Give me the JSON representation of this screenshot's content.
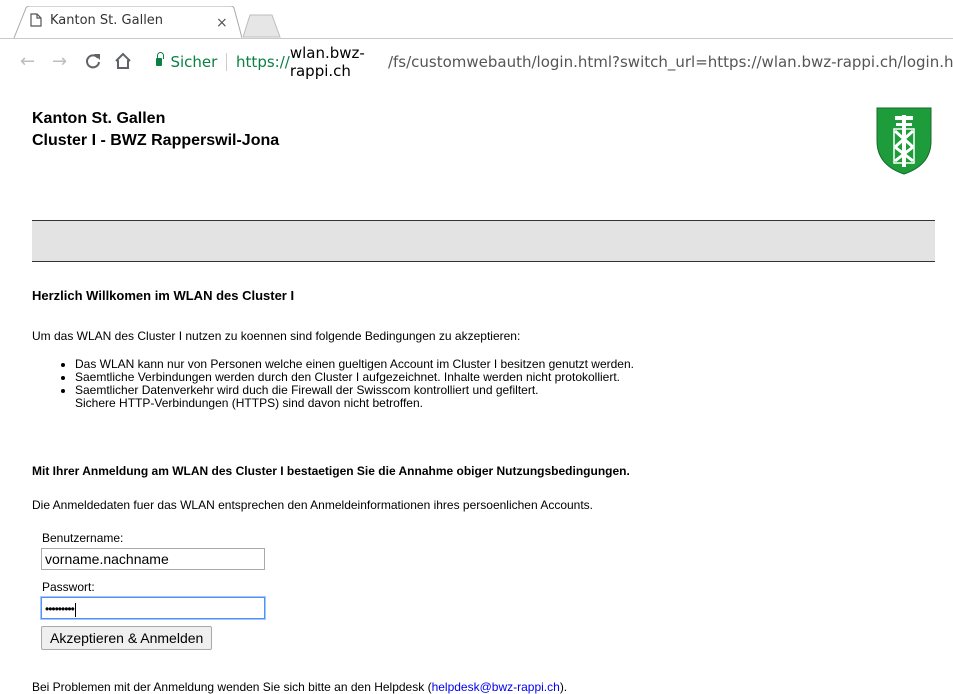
{
  "browser": {
    "tab_title": "Kanton St. Gallen",
    "tab_close": "×",
    "secure_label": "Sicher",
    "url_scheme": "https://",
    "url_host": "wlan.bwz-rappi.ch",
    "url_path": "/fs/customwebauth/login.html?switch_url=https://wlan.bwz-rappi.ch/login.htm"
  },
  "header": {
    "line1": "Kanton St. Gallen",
    "line2": "Cluster I - BWZ Rapperswil-Jona"
  },
  "content": {
    "heading": "Herzlich Willkomen im WLAN des Cluster I",
    "intro": "Um das WLAN des Cluster I nutzen zu koennen sind folgende Bedingungen zu akzeptieren:",
    "conditions": [
      "Das WLAN kann nur von Personen welche einen gueltigen Account im Cluster I besitzen genutzt werden.",
      "Saemtliche Verbindungen werden durch den Cluster I aufgezeichnet. Inhalte werden nicht protokolliert.",
      "Saemtlicher Datenverkehr wird duch die Firewall der Swisscom kontrolliert und gefiltert.",
      "Sichere HTTP-Verbindungen (HTTPS) sind davon nicht betroffen."
    ],
    "accept_notice": "Mit Ihrer Anmeldung am WLAN des Cluster I bestaetigen Sie die Annahme obiger Nutzungsbedingungen.",
    "credentials_info": "Die Anmeldedaten fuer das WLAN entsprechen den Anmeldeinformationen ihres persoenlichen Accounts."
  },
  "form": {
    "username_label": "Benutzername:",
    "username_value": "vorname.nachname",
    "password_label": "Passwort:",
    "password_value": "•••••••••",
    "submit_label": "Akzeptieren & Anmelden"
  },
  "footer": {
    "help_text": "Bei Problemen mit der Anmeldung wenden Sie sich bitte an den Helpdesk (",
    "help_link": "helpdesk@bwz-rappi.ch",
    "help_end": ")."
  },
  "colors": {
    "secure_green": "#0b8043",
    "crest_green": "#1e9b3a",
    "link_blue": "#0000ee"
  }
}
